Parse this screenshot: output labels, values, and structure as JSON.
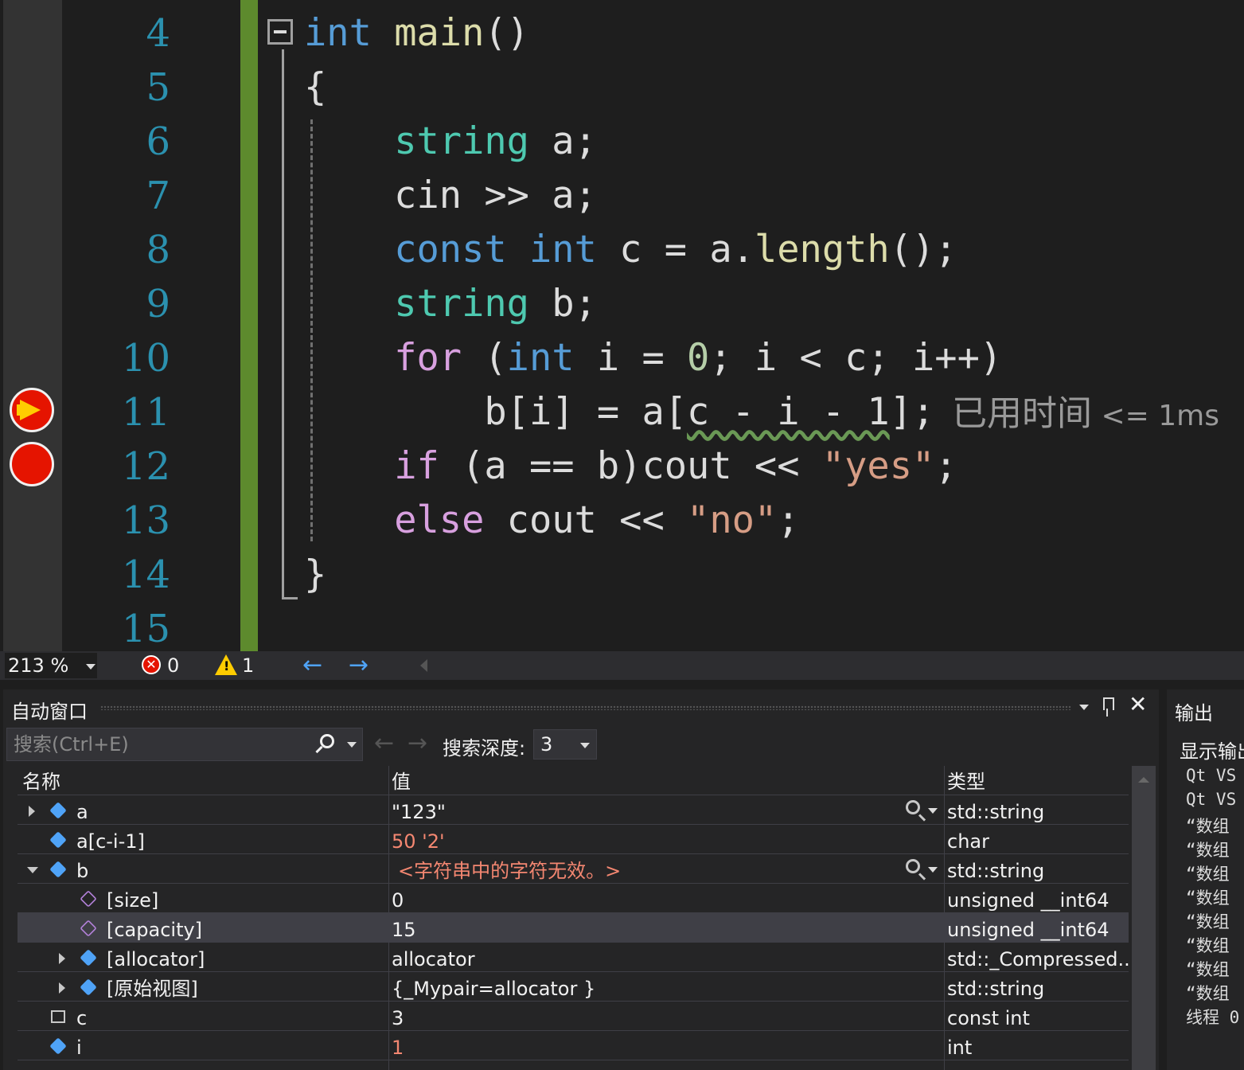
{
  "editor": {
    "line_numbers": [
      "4",
      "5",
      "6",
      "7",
      "8",
      "9",
      "10",
      "11",
      "12",
      "13",
      "14",
      "15"
    ],
    "lines": [
      [
        {
          "c": "kw",
          "t": "int"
        },
        {
          "c": "id",
          "t": " "
        },
        {
          "c": "fn",
          "t": "main"
        },
        {
          "c": "id",
          "t": "()"
        }
      ],
      [
        {
          "c": "id",
          "t": "{"
        }
      ],
      [
        {
          "c": "id",
          "t": "    "
        },
        {
          "c": "ty",
          "t": "string"
        },
        {
          "c": "id",
          "t": " a;"
        }
      ],
      [
        {
          "c": "id",
          "t": "    cin >> a;"
        }
      ],
      [
        {
          "c": "id",
          "t": "    "
        },
        {
          "c": "kw",
          "t": "const"
        },
        {
          "c": "id",
          "t": " "
        },
        {
          "c": "kw",
          "t": "int"
        },
        {
          "c": "id",
          "t": " c = a."
        },
        {
          "c": "fn",
          "t": "length"
        },
        {
          "c": "id",
          "t": "();"
        }
      ],
      [
        {
          "c": "id",
          "t": "    "
        },
        {
          "c": "ty",
          "t": "string"
        },
        {
          "c": "id",
          "t": " b;"
        }
      ],
      [
        {
          "c": "id",
          "t": "    "
        },
        {
          "c": "ctl",
          "t": "for"
        },
        {
          "c": "id",
          "t": " ("
        },
        {
          "c": "kw",
          "t": "int"
        },
        {
          "c": "id",
          "t": " i = "
        },
        {
          "c": "num",
          "t": "0"
        },
        {
          "c": "id",
          "t": "; i < c; i++)"
        }
      ],
      [
        {
          "c": "id",
          "t": "        b[i] = a["
        },
        {
          "c": "id sq",
          "t": "c - i - 1"
        },
        {
          "c": "id",
          "t": "];"
        }
      ],
      [
        {
          "c": "id",
          "t": "    "
        },
        {
          "c": "ctl",
          "t": "if"
        },
        {
          "c": "id",
          "t": " (a == b)cout << "
        },
        {
          "c": "str",
          "t": "\"yes\""
        },
        {
          "c": "id",
          "t": ";"
        }
      ],
      [
        {
          "c": "id",
          "t": "    "
        },
        {
          "c": "ctl",
          "t": "else"
        },
        {
          "c": "id",
          "t": " cout << "
        },
        {
          "c": "str",
          "t": "\"no\""
        },
        {
          "c": "id",
          "t": ";"
        }
      ],
      [
        {
          "c": "id",
          "t": "}"
        }
      ],
      []
    ],
    "elapsed_label": "已用时间",
    "elapsed_value": " <= 1ms"
  },
  "status": {
    "zoom": "213 %",
    "error_count": "0",
    "warning_count": "1",
    "back_arrow": "←",
    "forward_arrow": "→",
    "error_glyph": "✕",
    "warning_glyph": "!"
  },
  "autos": {
    "title": "自动窗口",
    "search_placeholder": "搜索(Ctrl+E)",
    "depth_label": "搜索深度:",
    "depth_value": "3",
    "columns": {
      "name": "名称",
      "value": "值",
      "type": "类型"
    },
    "rows": [
      {
        "name": "a",
        "value": "\"123\"",
        "type": "std::string"
      },
      {
        "name": "a[c-i-1]",
        "value": "50 '2'",
        "type": "char"
      },
      {
        "name": "b",
        "value": "<字符串中的字符无效。>",
        "type": "std::string"
      },
      {
        "name": "[size]",
        "value": "0",
        "type": "unsigned __int64"
      },
      {
        "name": "[capacity]",
        "value": "15",
        "type": "unsigned __int64"
      },
      {
        "name": "[allocator]",
        "value": "allocator",
        "type": "std::_Compressed..."
      },
      {
        "name": "[原始视图]",
        "value": "{_Mypair=allocator }",
        "type": "std::string"
      },
      {
        "name": "c",
        "value": "3",
        "type": "const int"
      },
      {
        "name": "i",
        "value": "1",
        "type": "int"
      }
    ]
  },
  "output": {
    "title": "输出",
    "show_from": "显示输出",
    "lines": [
      "Qt VS",
      "Qt VS",
      "“数组",
      "“数组",
      "“数组",
      "“数组",
      "“数组",
      "“数组",
      "“数组",
      "“数组",
      "线程 0"
    ]
  },
  "colors": {
    "accent_blue": "#569cd6",
    "breakpoint_red": "#e51400",
    "changed_lines_green": "#5d8a2d"
  }
}
